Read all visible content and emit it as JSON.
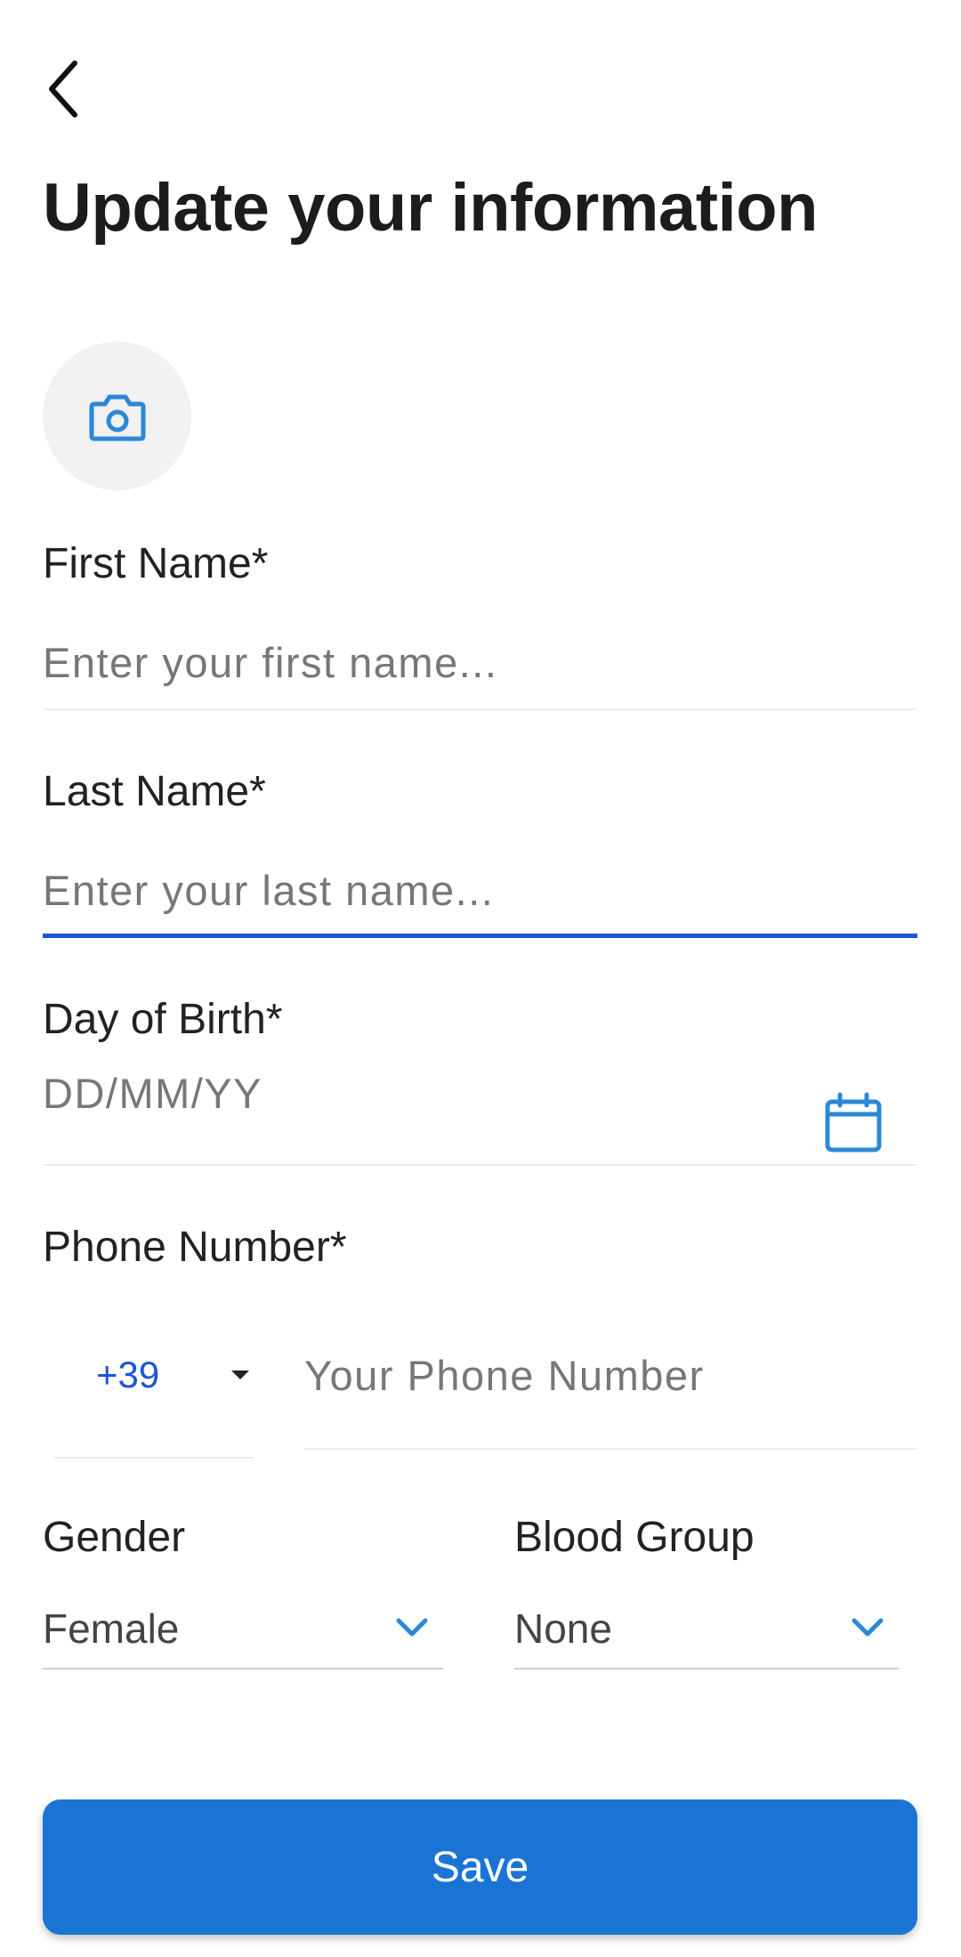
{
  "header": {
    "back_icon": "chevron-left-icon",
    "title": "Update your information"
  },
  "avatar": {
    "icon": "camera-icon",
    "accent_color": "#2b88d8"
  },
  "form": {
    "first_name": {
      "label": "First Name*",
      "placeholder": "Enter your first name...",
      "value": ""
    },
    "last_name": {
      "label": "Last Name*",
      "placeholder": "Enter your last name...",
      "value": "",
      "focused": true
    },
    "birth_date": {
      "label": "Day of Birth*",
      "placeholder": "DD/MM/YY",
      "value": "",
      "icon": "calendar-icon"
    },
    "phone": {
      "label": "Phone Number*",
      "country_code": "+39",
      "placeholder": "Your Phone Number",
      "value": ""
    },
    "gender": {
      "label": "Gender",
      "selected": "Female",
      "icon": "chevron-down-icon"
    },
    "blood_group": {
      "label": "Blood Group",
      "selected": "None",
      "icon": "chevron-down-icon"
    }
  },
  "actions": {
    "save_label": "Save"
  },
  "colors": {
    "primary": "#1a74d4",
    "focus_underline": "#1a56db",
    "icon_blue": "#2b88d8"
  }
}
